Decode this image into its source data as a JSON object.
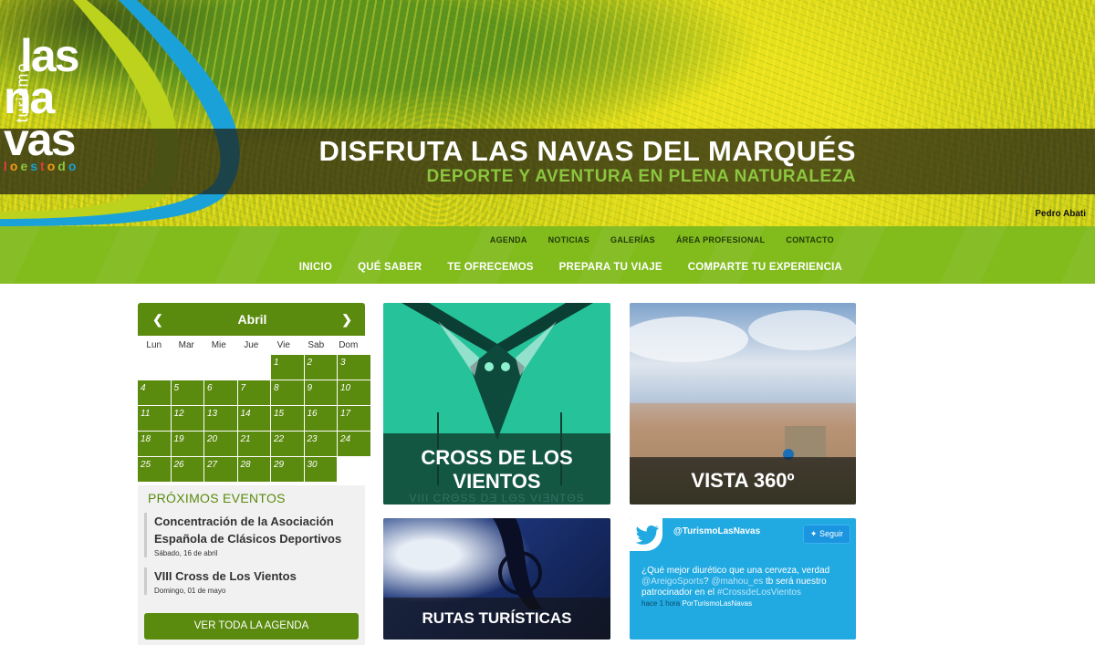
{
  "hero": {
    "title": "DISFRUTA LAS NAVAS DEL MARQUÉS",
    "subtitle": "DEPORTE Y AVENTURA EN PLENA NATURALEZA",
    "photo_credit": "Pedro Abati"
  },
  "logo": {
    "vertical": "turismo",
    "line1": "las",
    "line2": "na",
    "line3": "vas",
    "tagline": "loestodo"
  },
  "nav": {
    "top_items": [
      "AGENDA",
      "NOTICIAS",
      "GALERÍAS",
      "ÁREA PROFESIONAL",
      "CONTACTO"
    ],
    "main_items": [
      "INICIO",
      "QUÉ SABER",
      "TE OFRECEMOS",
      "PREPARA TU VIAJE",
      "COMPARTE TU EXPERIENCIA"
    ]
  },
  "calendar": {
    "month": "Abril",
    "prev_icon": "chevron-left-icon",
    "next_icon": "chevron-right-icon",
    "weekdays": [
      "Lun",
      "Mar",
      "Mie",
      "Jue",
      "Vie",
      "Sab",
      "Dom"
    ],
    "days": [
      "1",
      "2",
      "3",
      "4",
      "5",
      "6",
      "7",
      "8",
      "9",
      "10",
      "11",
      "12",
      "13",
      "14",
      "15",
      "16",
      "17",
      "18",
      "19",
      "20",
      "21",
      "22",
      "23",
      "24",
      "25",
      "26",
      "27",
      "28",
      "29",
      "30"
    ]
  },
  "events": {
    "title": "PRÓXIMOS EVENTOS",
    "items": [
      {
        "name": "Concentración de la Asociación Española de Clásicos Deportivos",
        "date": "Sábado, 16 de abril"
      },
      {
        "name": "VIII Cross de Los Vientos",
        "date": "Domingo, 01 de mayo"
      }
    ],
    "button": "VER TODA LA AGENDA"
  },
  "tiles": {
    "cross": "CROSS DE LOS VIENTOS",
    "cross_faint": "VIII CRΘSS DƎ LΘS VIƎNTΘS",
    "vista": "VISTA 360º",
    "rutas": "RUTAS TURÍSTICAS"
  },
  "twitter": {
    "handle": "@TurismoLasNavas",
    "follow": "Seguir",
    "text_prefix": "¿Qué mejor diurético que una cerveza, verdad",
    "mention1": "@AreigoSports",
    "sep": "?",
    "mention2": "@mahou_es",
    "mid": "tb será nuestro patrocinador en el",
    "hashtag": "#CrossdeLosVientos",
    "time": "hace 1 hora",
    "via": "PorTurismoLasNavas"
  },
  "colors": {
    "brand_green": "#81bb1c",
    "dark_green": "#5a8a0e",
    "twitter_blue": "#21a9e1",
    "teal": "#26c39a"
  }
}
